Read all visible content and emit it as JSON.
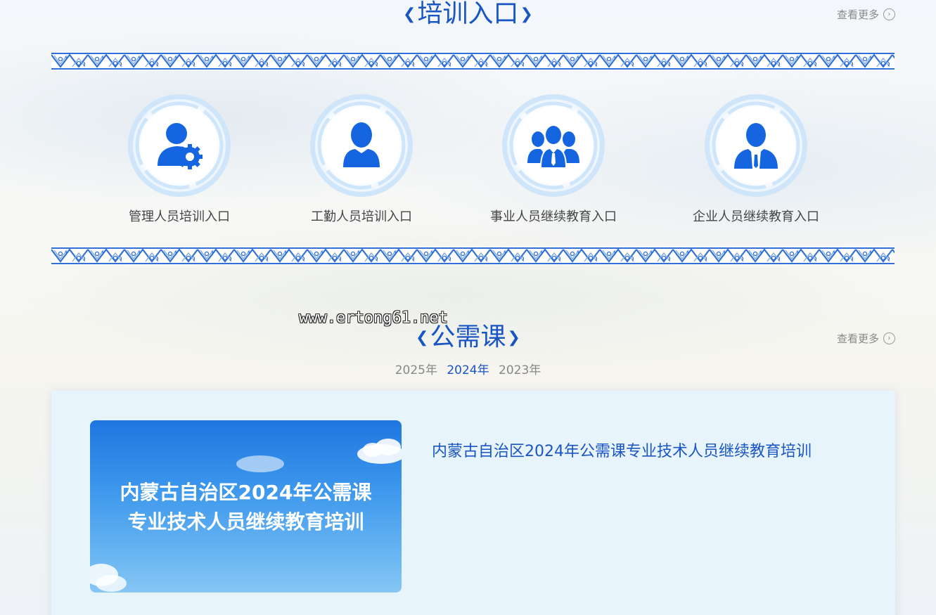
{
  "training_section": {
    "title": "培训入口",
    "more_label": "查看更多",
    "entries": [
      {
        "label": "管理人员培训入口",
        "icon": "admin-user-gear-icon"
      },
      {
        "label": "工勤人员培训入口",
        "icon": "user-icon"
      },
      {
        "label": "事业人员继续教育入口",
        "icon": "group-users-icon"
      },
      {
        "label": "企业人员继续教育入口",
        "icon": "businessman-icon"
      }
    ]
  },
  "public_course_section": {
    "title": "公需课",
    "more_label": "查看更多",
    "years": [
      "2025年",
      "2024年",
      "2023年"
    ],
    "active_year": "2024年",
    "course": {
      "thumb_line1": "内蒙古自治区2024年公需课",
      "thumb_line2": "专业技术人员继续教育培训",
      "title": "内蒙古自治区2024年公需课专业技术人员继续教育培训"
    }
  },
  "watermark": "www.ertong61.net",
  "colors": {
    "accent": "#1a55c4",
    "icon_blue": "#1565e0",
    "ring_light": "#bcdcf6",
    "card_bg": "#e8f4fc"
  }
}
